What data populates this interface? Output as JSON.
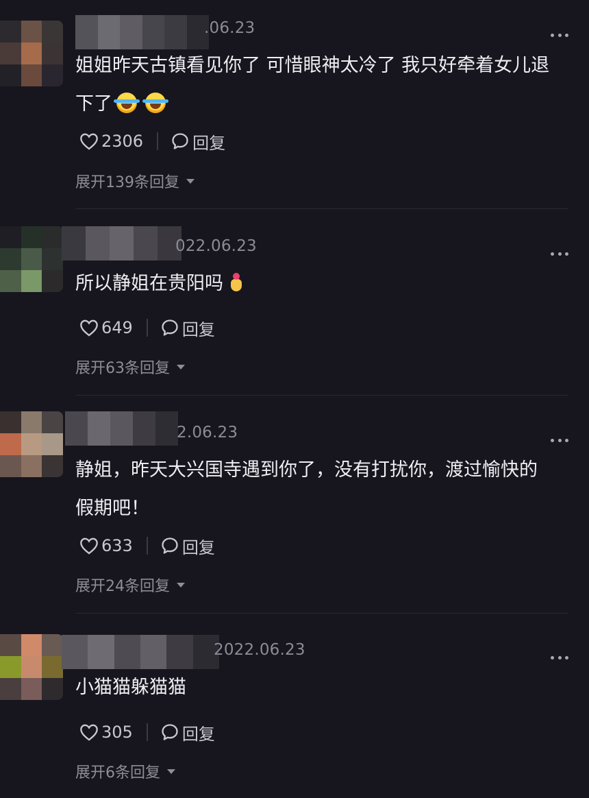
{
  "comments": [
    {
      "date": ".06.23",
      "text_line1": "姐姐昨天古镇看见你了 可惜眼神太冷了 我只好牵着女儿退",
      "text_line2": "下了",
      "emojis": [
        "rofl-emoji",
        "rofl-emoji"
      ],
      "likes": "2306",
      "reply_label": "回复",
      "expand_label": "展开139条回复"
    },
    {
      "date": "022.06.23",
      "text_line1": "所以静姐在贵阳吗",
      "text_line2": "",
      "emojis": [
        "pray-hands-emoji"
      ],
      "likes": "649",
      "reply_label": "回复",
      "expand_label": "展开63条回复"
    },
    {
      "date": "2.06.23",
      "text_line1": "静姐，昨天大兴国寺遇到你了，没有打扰你，渡过愉快的",
      "text_line2": "假期吧！",
      "emojis": [],
      "likes": "633",
      "reply_label": "回复",
      "expand_label": "展开24条回复"
    },
    {
      "date": "2022.06.23",
      "text_line1": "小猫猫躲猫猫",
      "text_line2": "",
      "emojis": [],
      "likes": "305",
      "reply_label": "回复",
      "expand_label": "展开6条回复"
    }
  ],
  "icons": {
    "like": "heart-outline-icon",
    "reply": "speech-bubble-icon",
    "more": "more-dots-icon",
    "expand": "caret-down-icon"
  },
  "colors": {
    "background": "#17161e",
    "text": "#efeef3",
    "meta": "#8c8b96"
  }
}
